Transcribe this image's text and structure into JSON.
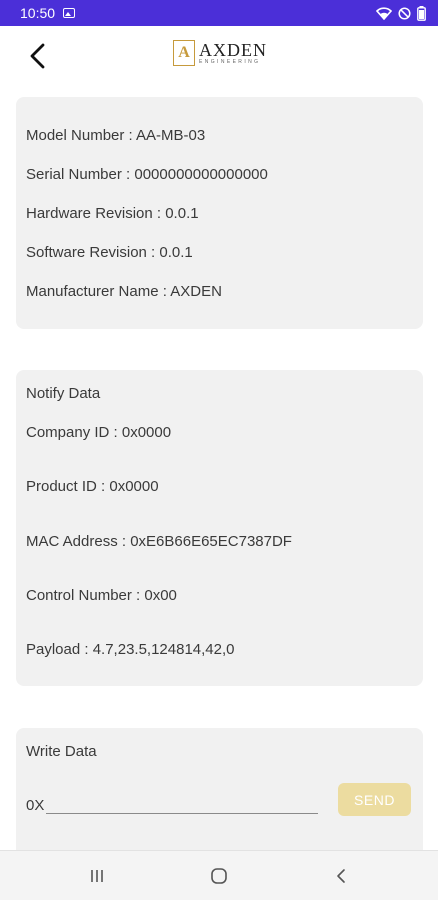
{
  "status_bar": {
    "time": "10:50",
    "background": "#4b2fd8"
  },
  "header": {
    "logo_mark": "A",
    "logo_name": "AXDEN",
    "logo_sub": "ENGINEERING"
  },
  "device_info": {
    "model_number": "Model Number : AA-MB-03",
    "serial_number": "Serial Number : 0000000000000000",
    "hardware_revision": "Hardware Revision : 0.0.1",
    "software_revision": "Software Revision : 0.0.1",
    "manufacturer_name": "Manufacturer Name : AXDEN"
  },
  "notify": {
    "title": "Notify Data",
    "company_id": "Company ID : 0x0000",
    "product_id": "Product ID : 0x0000",
    "mac_address": "MAC Address : 0xE6B66E65EC7387DF",
    "control_number": "Control Number : 0x00",
    "payload": "Payload : 4.7,23.5,124814,42,0"
  },
  "write": {
    "title": "Write Data",
    "prefix": "0X",
    "input_value": "",
    "send_label": "SEND",
    "send_color": "#ecdca0"
  },
  "icons": [
    "back-arrow-icon",
    "wifi-icon",
    "do-not-disturb-icon",
    "battery-icon",
    "image-icon",
    "recents-icon",
    "home-icon",
    "back-icon"
  ]
}
